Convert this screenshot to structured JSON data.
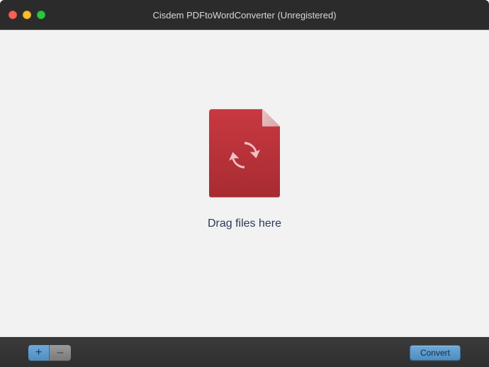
{
  "titlebar": {
    "title": "Cisdem PDFtoWordConverter (Unregistered)"
  },
  "main": {
    "drop_text": "Drag files here"
  },
  "bottombar": {
    "add_label": "+",
    "remove_label": "–",
    "convert_label": "Convert"
  }
}
